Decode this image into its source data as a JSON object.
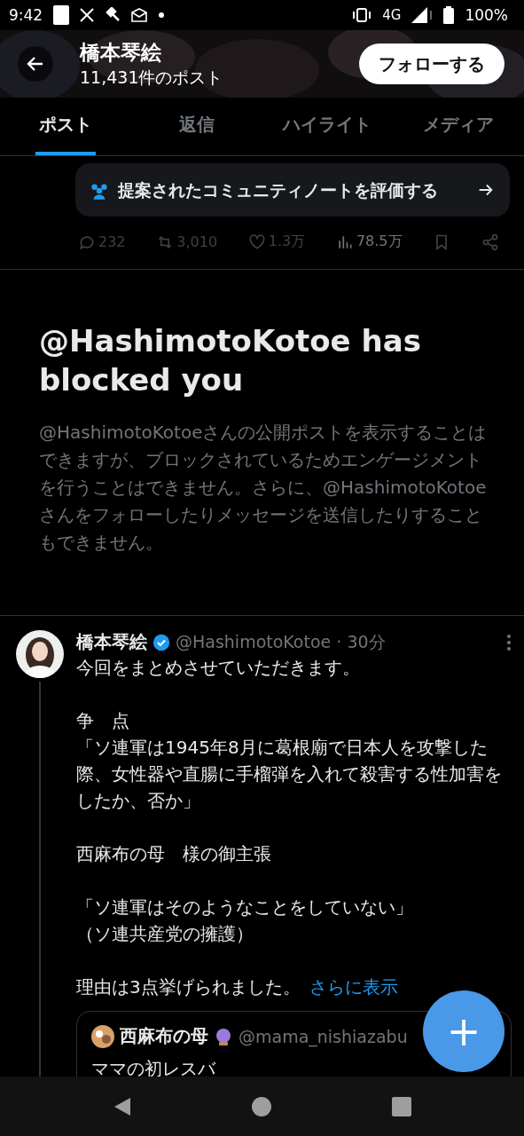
{
  "status_bar": {
    "time": "9:42",
    "network": "4G",
    "battery": "100%"
  },
  "header": {
    "name": "橋本琴絵",
    "post_count": "11,431件のポスト",
    "follow_button": "フォローする"
  },
  "tabs": [
    {
      "label": "ポスト",
      "selected": true
    },
    {
      "label": "返信",
      "selected": false
    },
    {
      "label": "ハイライト",
      "selected": false
    },
    {
      "label": "メディア",
      "selected": false
    }
  ],
  "community_note": {
    "text": "提案されたコミュニティノートを評価する"
  },
  "actions": [
    {
      "kind": "reply",
      "count": "232"
    },
    {
      "kind": "repost",
      "count": "3,010"
    },
    {
      "kind": "like",
      "count": "1.3万"
    },
    {
      "kind": "views",
      "count": "78.5万"
    },
    {
      "kind": "bookmark"
    },
    {
      "kind": "share"
    }
  ],
  "blocked_notice": {
    "title": "@HashimotoKotoe has blocked you",
    "body": "@HashimotoKotoeさんの公開ポストを表示することはできますが、ブロックされているためエンゲージメントを行うことはできません。さらに、@HashimotoKotoeさんをフォローしたりメッセージを送信したりすることもできません。"
  },
  "post": {
    "name": "橋本琴絵",
    "verified": true,
    "handle": "@HashimotoKotoe",
    "time": "30分",
    "separator": "·",
    "paragraphs": [
      [
        "今回をまとめさせていただきます。"
      ],
      [
        "争　点",
        "「ソ連軍は1945年8月に葛根廟で日本人を攻撃した際、女性器や直腸に手榴弾を入れて殺害する性加害をしたか、否か」"
      ],
      [
        "西麻布の母　様の御主張"
      ],
      [
        "「ソ連軍はそのようなことをしていない」",
        "（ソ連共産党の擁護）"
      ]
    ],
    "last_line": "理由は3点挙げられました。",
    "show_more": "さらに表示",
    "quote": {
      "name": "西麻布の母",
      "handle": "@mama_nishiazabu",
      "text": "ママの初レスバ"
    }
  },
  "fab": {
    "label": "+"
  }
}
